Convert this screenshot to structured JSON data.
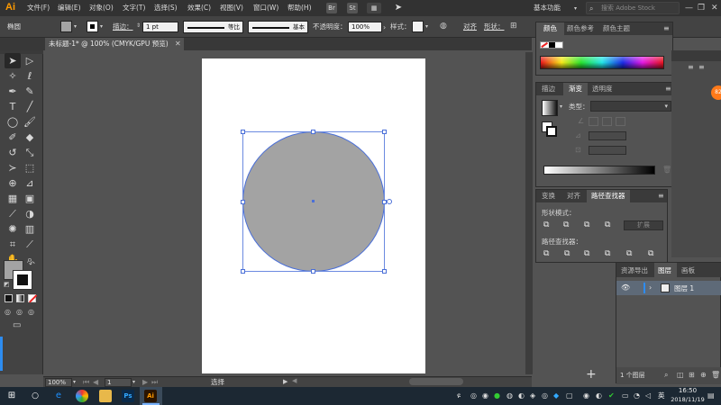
{
  "app": {
    "logo": "Ai",
    "menus": [
      "文件(F)",
      "编辑(E)",
      "对象(O)",
      "文字(T)",
      "选择(S)",
      "效果(C)",
      "视图(V)",
      "窗口(W)",
      "帮助(H)"
    ],
    "bridge_icon": "Br",
    "stock_icon": "St",
    "workspace": "基本功能",
    "search_placeholder": "搜索 Adobe Stock"
  },
  "control_bar": {
    "selection": "椭圆",
    "stroke_label": "描边：",
    "stroke_value": "1 pt",
    "profile_1": "等比",
    "profile_2": "基本",
    "opacity_label": "不透明度：",
    "opacity_value": "100%",
    "style_label": "样式：",
    "align_label": "对齐",
    "shape_label": "形状："
  },
  "document": {
    "tab_title": "未标题-1* @ 100% (CMYK/GPU 预览)",
    "close": "✕"
  },
  "status_bar": {
    "zoom": "100%",
    "artboard": "1",
    "mode": "选择"
  },
  "color_panel": {
    "tabs": [
      "颜色",
      "颜色参考",
      "颜色主题"
    ]
  },
  "gradient_panel": {
    "tabs": [
      "描边",
      "渐变",
      "透明度"
    ],
    "type_label": "类型："
  },
  "pathfinder_panel": {
    "tabs": [
      "变换",
      "对齐",
      "路径查找器"
    ],
    "shape_modes": "形状模式：",
    "pathfinders": "路径查找器：",
    "expand": "扩展"
  },
  "layers_panel": {
    "tabs": [
      "资源导出",
      "图层",
      "画板"
    ],
    "layer_name": "图层 1",
    "count": "1 个图层"
  },
  "taskbar": {
    "time": "16:50",
    "date": "2018/11/19",
    "ime": "英"
  },
  "colors": {
    "accent": "#4a6fd8",
    "circle_fill": "#a3a3a3",
    "logo": "#ff9a00"
  }
}
